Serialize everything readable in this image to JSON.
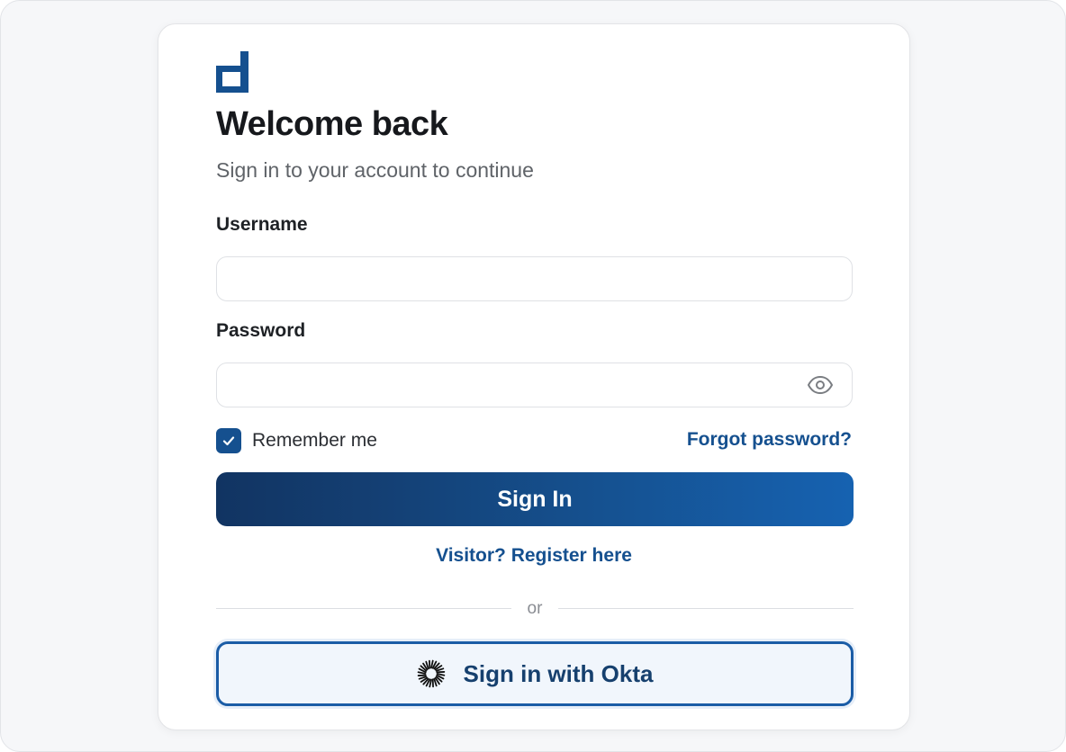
{
  "colors": {
    "brand": "#15508f",
    "brand_dark": "#113462",
    "link": "#15508f",
    "page_background": "#f6f7f9",
    "card_background": "#ffffff"
  },
  "logo": {
    "icon": "d-logo-icon"
  },
  "heading": {
    "title": "Welcome back",
    "subtitle": "Sign in to your account to continue"
  },
  "form": {
    "username": {
      "label": "Username",
      "value": "",
      "placeholder": ""
    },
    "password": {
      "label": "Password",
      "value": "",
      "placeholder": "",
      "toggle_icon": "eye-icon"
    },
    "remember_me": {
      "label": "Remember me",
      "checked": true
    },
    "forgot_password_link": "Forgot password?",
    "submit_label": "Sign In",
    "register_link": "Visitor? Register here"
  },
  "divider_text": "or",
  "sso": {
    "label": "Sign in with Okta",
    "icon": "okta-icon"
  }
}
